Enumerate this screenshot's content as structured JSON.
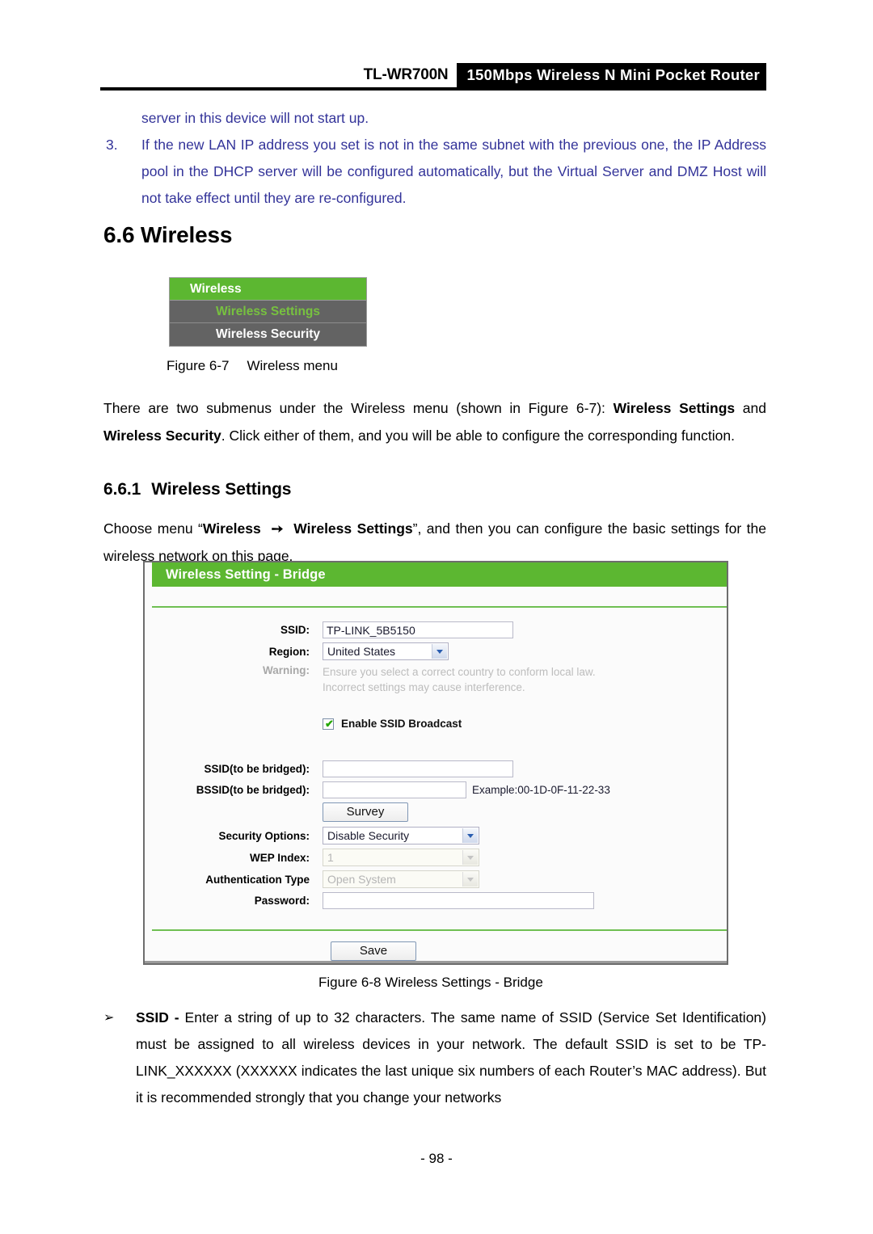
{
  "header": {
    "model": "TL-WR700N",
    "banner": "150Mbps Wireless N Mini Pocket Router"
  },
  "notes": {
    "continued_line": "server in this device will not start up.",
    "item_number": "3.",
    "item_text": "If the new LAN IP address you set is not in the same subnet with the previous one, the IP Address pool in the DHCP server will be configured automatically, but the Virtual Server and DMZ Host will not take effect until they are re-configured."
  },
  "section": {
    "number": "6.6",
    "title": "Wireless",
    "heading": "6.6  Wireless"
  },
  "menu_figure": {
    "header": "Wireless",
    "items": [
      {
        "label": "Wireless Settings",
        "active": true
      },
      {
        "label": "Wireless Security",
        "active": false
      }
    ],
    "colors": {
      "header_green": "#5cb731",
      "row_gray": "#636363",
      "active_green": "#77c13f"
    }
  },
  "captions": {
    "fig_6_7_prefix": "Figure 6-7",
    "fig_6_7_text": "Wireless menu",
    "fig_6_8": "Figure 6-8 Wireless Settings - Bridge"
  },
  "paragraphs": {
    "submenus_p1": "There are two submenus under the Wireless menu (shown in Figure 6-7): ",
    "submenus_b1": "Wireless Settings",
    "submenus_p2": " and ",
    "submenus_b2": "Wireless Security",
    "submenus_p3": ". Click either of them, and you will be able to configure the corresponding function.",
    "choose_p1": "Choose menu “",
    "choose_b1": "Wireless",
    "choose_arrow": "➙",
    "choose_b2": "Wireless Settings",
    "choose_p2": "”, and then you can configure the basic settings for the wireless network on this page."
  },
  "subsection": {
    "number": "6.6.1",
    "title": "Wireless Settings"
  },
  "router_ui": {
    "panel_title": "Wireless Setting - Bridge",
    "fields": {
      "ssid_label": "SSID:",
      "ssid_value": "TP-LINK_5B5150",
      "region_label": "Region:",
      "region_value": "United States",
      "warning_label": "Warning:",
      "warning_line1": "Ensure you select a correct country to conform local law.",
      "warning_line2": "Incorrect settings may cause interference.",
      "broadcast_label": "Enable SSID Broadcast",
      "broadcast_checked": "✔",
      "ssid_bridged_label": "SSID(to be bridged):",
      "ssid_bridged_value": "",
      "bssid_bridged_label": "BSSID(to be bridged):",
      "bssid_bridged_value": "",
      "bssid_example": "Example:00-1D-0F-11-22-33",
      "survey_button": "Survey",
      "security_options_label": "Security Options:",
      "security_options_value": "Disable Security",
      "wep_index_label": "WEP Index:",
      "wep_index_value": "1",
      "auth_type_label": "Authentication Type",
      "auth_type_value": "Open System",
      "password_label": "Password:",
      "password_value": "",
      "save_button": "Save"
    },
    "colors": {
      "title_green": "#5cb731",
      "rule_green": "#6fbf52",
      "panel_border": "#6d6d6d",
      "disabled_text": "#b5b5b5"
    }
  },
  "bullet": {
    "marker": "➢",
    "term": "SSID - ",
    "text": "Enter a string of up to 32 characters. The same name of SSID (Service Set Identification) must be assigned to all wireless devices in your network. The default SSID is set to be TP-LINK_XXXXXX (XXXXXX indicates the last unique six numbers of each Router’s MAC address). But it is recommended strongly that you change your networks"
  },
  "footer": {
    "page_number": "- 98 -"
  }
}
